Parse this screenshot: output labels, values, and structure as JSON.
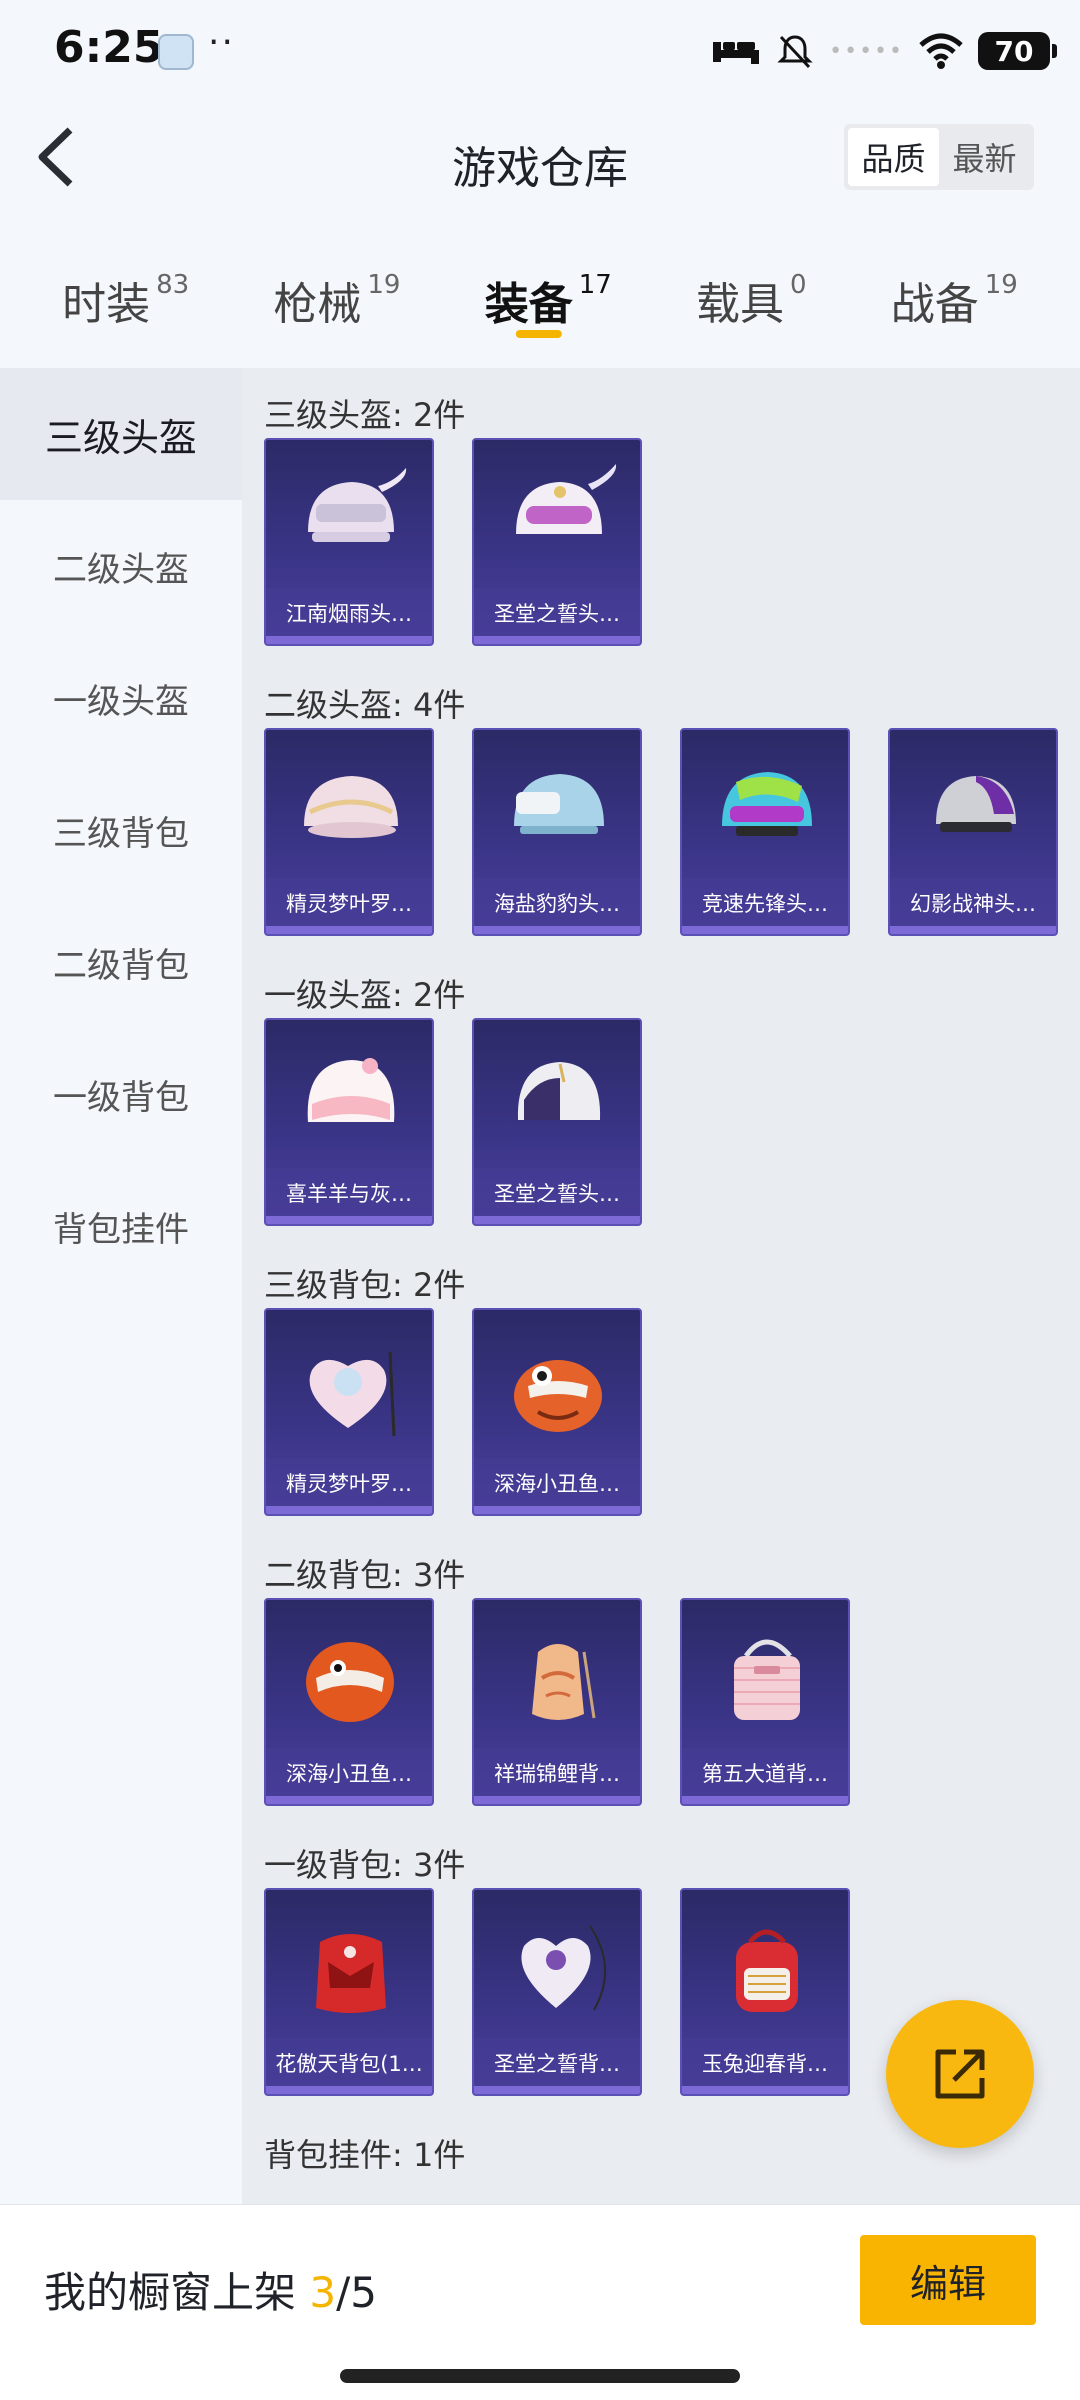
{
  "status_bar": {
    "time": "6:25",
    "dots": "··",
    "signal_dots": "•••••",
    "battery": "70"
  },
  "header": {
    "title": "游戏仓库",
    "sort_quality": "品质",
    "sort_latest": "最新"
  },
  "tabs": [
    {
      "label": "时装",
      "count": "83"
    },
    {
      "label": "枪械",
      "count": "19"
    },
    {
      "label": "装备",
      "count": "17"
    },
    {
      "label": "载具",
      "count": "0"
    },
    {
      "label": "战备",
      "count": "19"
    }
  ],
  "sidebar": {
    "items": [
      {
        "label": "三级头盔"
      },
      {
        "label": "二级头盔"
      },
      {
        "label": "一级头盔"
      },
      {
        "label": "三级背包"
      },
      {
        "label": "二级背包"
      },
      {
        "label": "一级背包"
      },
      {
        "label": "背包挂件"
      }
    ]
  },
  "groups": [
    {
      "title": "三级头盔: 2件",
      "items": [
        {
          "name": "江南烟雨头…",
          "icon": "helmet-icon"
        },
        {
          "name": "圣堂之誓头…",
          "icon": "helmet-icon"
        }
      ]
    },
    {
      "title": "二级头盔: 4件",
      "items": [
        {
          "name": "精灵梦叶罗…",
          "icon": "helmet-icon"
        },
        {
          "name": "海盐豹豹头…",
          "icon": "helmet-icon"
        },
        {
          "name": "竞速先锋头…",
          "icon": "helmet-icon"
        },
        {
          "name": "幻影战神头…",
          "icon": "helmet-icon"
        }
      ]
    },
    {
      "title": "一级头盔: 2件",
      "items": [
        {
          "name": "喜羊羊与灰…",
          "icon": "helmet-icon"
        },
        {
          "name": "圣堂之誓头…",
          "icon": "helmet-icon"
        }
      ]
    },
    {
      "title": "三级背包: 2件",
      "items": [
        {
          "name": "精灵梦叶罗…",
          "icon": "backpack-icon"
        },
        {
          "name": "深海小丑鱼…",
          "icon": "backpack-icon"
        }
      ]
    },
    {
      "title": "二级背包: 3件",
      "items": [
        {
          "name": "深海小丑鱼…",
          "icon": "backpack-icon"
        },
        {
          "name": "祥瑞锦鲤背…",
          "icon": "backpack-icon"
        },
        {
          "name": "第五大道背…",
          "icon": "backpack-icon"
        }
      ]
    },
    {
      "title": "一级背包: 3件",
      "items": [
        {
          "name": "花傲天背包(1…",
          "icon": "backpack-icon"
        },
        {
          "name": "圣堂之誓背…",
          "icon": "backpack-icon"
        },
        {
          "name": "玉兔迎春背…",
          "icon": "backpack-icon"
        }
      ]
    },
    {
      "title": "背包挂件: 1件",
      "items": []
    }
  ],
  "bottom_bar": {
    "showcase_label": "我的橱窗上架 ",
    "showcase_current": "3",
    "showcase_total": "/5",
    "edit_label": "编辑"
  },
  "colors": {
    "accent": "#f8b400",
    "card_top": "#2b2a66",
    "card_bottom": "#4a3f9c"
  }
}
